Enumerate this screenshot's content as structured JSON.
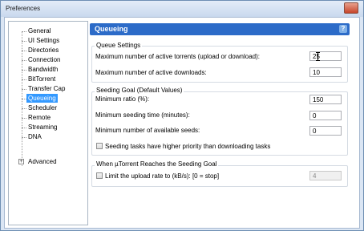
{
  "window": {
    "title": "Preferences"
  },
  "sidebar": {
    "items": [
      {
        "label": "General"
      },
      {
        "label": "UI Settings"
      },
      {
        "label": "Directories"
      },
      {
        "label": "Connection"
      },
      {
        "label": "Bandwidth"
      },
      {
        "label": "BitTorrent"
      },
      {
        "label": "Transfer Cap"
      },
      {
        "label": "Queueing",
        "selected": true
      },
      {
        "label": "Scheduler"
      },
      {
        "label": "Remote"
      },
      {
        "label": "Streaming"
      },
      {
        "label": "DNA"
      },
      {
        "label": "Advanced",
        "expandable": true,
        "expander": "+"
      }
    ]
  },
  "panel": {
    "title": "Queueing",
    "help_icon": "?",
    "queue_settings": {
      "title": "Queue Settings",
      "max_active_torrents_label": "Maximum number of active torrents (upload or download):",
      "max_active_torrents_value": "25",
      "max_active_downloads_label": "Maximum number of active downloads:",
      "max_active_downloads_value": "10"
    },
    "seeding_goal": {
      "title": "Seeding Goal (Default Values)",
      "min_ratio_label": "Minimum ratio (%):",
      "min_ratio_value": "150",
      "min_seeding_time_label": "Minimum seeding time (minutes):",
      "min_seeding_time_value": "0",
      "min_seeds_label": "Minimum number of available seeds:",
      "min_seeds_value": "0",
      "priority_checkbox_label": "Seeding tasks have higher priority than downloading tasks",
      "priority_checked": false
    },
    "reaches_goal": {
      "title": "When µTorrent Reaches the Seeding Goal",
      "limit_upload_label": "Limit the upload rate to (kB/s): [0 = stop]",
      "limit_upload_checked": false,
      "limit_upload_value": "4"
    }
  }
}
